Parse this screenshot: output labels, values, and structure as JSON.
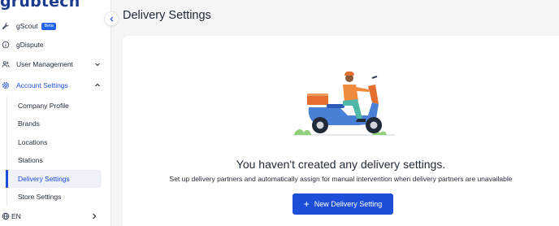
{
  "sidebar": {
    "logo": "grubtech",
    "items": [
      {
        "label": "gScout",
        "badge": "Beta"
      },
      {
        "label": "gDispute"
      },
      {
        "label": "User Management"
      },
      {
        "label": "Account Settings"
      }
    ],
    "sub_items": [
      {
        "label": "Company Profile"
      },
      {
        "label": "Brands"
      },
      {
        "label": "Locations"
      },
      {
        "label": "Stations"
      },
      {
        "label": "Delivery Settings"
      },
      {
        "label": "Store Settings"
      }
    ],
    "language": "EN"
  },
  "main": {
    "title": "Delivery Settings",
    "empty_title": "You haven't created any delivery settings.",
    "empty_description": "Set up delivery partners and automatically assign for manual intervention when delivery partners are unavailable",
    "new_button_label": "New Delivery Setting"
  },
  "colors": {
    "accent": "#1d4ed8",
    "active_bg": "#eef1f7",
    "scooter": "#4a7fd6",
    "rider_shirt": "#f08a3c",
    "box": "#e56f2e"
  },
  "icons": [
    "wrench-icon",
    "info-icon",
    "users-icon",
    "gear-icon",
    "globe-icon",
    "chevron-down-icon",
    "chevron-up-icon",
    "chevron-right-icon",
    "chevron-left-icon",
    "plus-icon"
  ]
}
